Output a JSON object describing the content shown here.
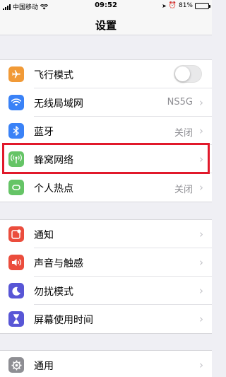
{
  "status_bar": {
    "carrier": "中国移动",
    "time": "09:52",
    "battery_percent_label": "81%",
    "battery_level": 0.81
  },
  "nav": {
    "title": "设置"
  },
  "colors": {
    "airplane": "#f19a37",
    "wifi": "#3a82f7",
    "bluetooth": "#3a82f7",
    "cellular": "#65c466",
    "hotspot": "#65c466",
    "notifications": "#eb4d3d",
    "sounds": "#eb4d3d",
    "dnd": "#5856d6",
    "screen_time": "#5856d6",
    "general": "#8e8e93",
    "highlight": "#e1192b"
  },
  "groups": [
    {
      "items": [
        {
          "icon": "airplane-icon",
          "label": "飞行模式",
          "control": "toggle",
          "on": false
        },
        {
          "icon": "wifi-icon",
          "label": "无线局域网",
          "value": "NS5G"
        },
        {
          "icon": "bluetooth-icon",
          "label": "蓝牙",
          "value": "关闭"
        },
        {
          "icon": "cellular-icon",
          "label": "蜂窝网络",
          "value": "",
          "highlighted": true
        },
        {
          "icon": "hotspot-icon",
          "label": "个人热点",
          "value": "关闭"
        }
      ]
    },
    {
      "items": [
        {
          "icon": "notifications-icon",
          "label": "通知"
        },
        {
          "icon": "sounds-icon",
          "label": "声音与触感"
        },
        {
          "icon": "moon-icon",
          "label": "勿扰模式"
        },
        {
          "icon": "hourglass-icon",
          "label": "屏幕使用时间"
        }
      ]
    },
    {
      "items": [
        {
          "icon": "gear-icon",
          "label": "通用"
        }
      ]
    }
  ]
}
